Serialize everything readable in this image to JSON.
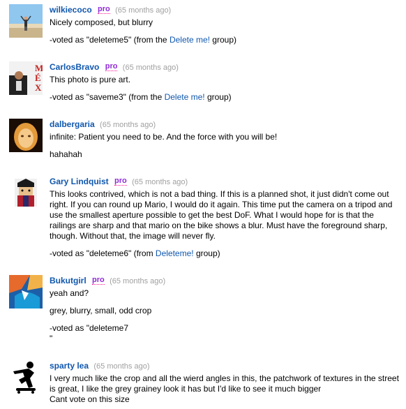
{
  "comments": [
    {
      "user": "wilkiecoco",
      "pro": "pro",
      "age": "(65 months ago)",
      "text": "Nicely composed, but blurry",
      "vote_prefix": "-voted as \"deleteme5\" (from the ",
      "vote_group": "Delete me!",
      "vote_suffix": " group)"
    },
    {
      "user": "CarlosBravo",
      "pro": "pro",
      "age": "(65 months ago)",
      "text": "This photo is pure art.",
      "vote_prefix": "-voted as \"saveme3\" (from the ",
      "vote_group": "Delete me!",
      "vote_suffix": " group)",
      "avatar_text": [
        "M",
        "É",
        "X"
      ]
    },
    {
      "user": "dalbergaria",
      "age": "(65 months ago)",
      "text": "infinite: Patient you need to be. And the force with you will be!",
      "text2": "hahahah"
    },
    {
      "user": "Gary Lindquist",
      "pro": "pro",
      "age": "(65 months ago)",
      "text": "This looks contrived, which is not a bad thing. If this is a planned shot, it just didn't come out right. If you can round up Mario, I would do it again. This time put the camera on a tripod and use the smallest aperture possible to get the best DoF. What I would hope for is that the railings are sharp and that mario on the bike shows a blur. Must have the foreground sharp, though. Without that, the image will never fly.",
      "vote_prefix": "-voted as \"deleteme6\" (from ",
      "vote_group": "Deleteme!",
      "vote_suffix": " group)"
    },
    {
      "user": "Bukutgirl",
      "pro": "pro",
      "age": "(65 months ago)",
      "text": "yeah and?",
      "text2": "grey, blurry, small, odd crop",
      "text3": "-voted as \"deleteme7",
      "text4": "\""
    },
    {
      "user": "sparty lea",
      "age": "(65 months ago)",
      "text": "I very much like the crop and all the wierd angles in this, the patchwork of textures in the street is great, I like the grey grainey look it has but I'd like to see it much bigger",
      "text2": "Cant vote on this size"
    }
  ]
}
